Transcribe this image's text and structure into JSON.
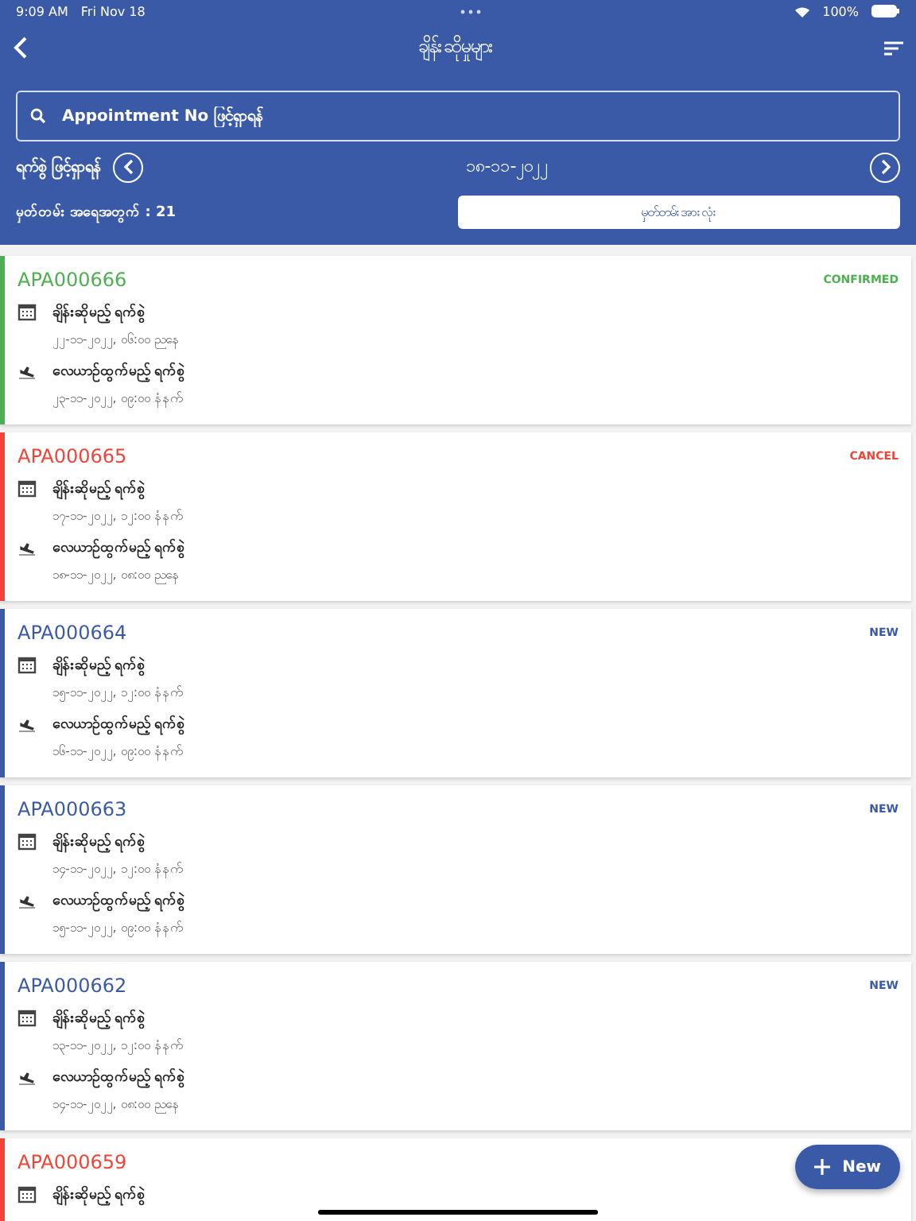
{
  "status_bar": {
    "time": "9:09 AM",
    "date": "Fri Nov 18",
    "battery": "100%"
  },
  "nav": {
    "title": "ချိန်းဆိုမှုများ"
  },
  "search": {
    "placeholder": "Appointment No ဖြင့်ရှာရန်"
  },
  "date_filter": {
    "label": "ရက်စွဲ ဖြင့်ရှာရန်",
    "date": "၁၈-၁၁-၂၀၂၂"
  },
  "summary": {
    "count_label": "မှတ်တမ်း အရေအတွက် : 21",
    "all_button": "မှတ်တမ်းအားလုံး"
  },
  "appointments": [
    {
      "id": "APA000666",
      "status": "CONFIRMED",
      "color": "#4caf50",
      "rows": [
        {
          "kind": "calendar",
          "label": "ချိန်းဆိုမည့် ရက်စွဲ",
          "value": "၂၂-၁၁-၂၀၂၂, ၀၆:၀၀ ညနေ"
        },
        {
          "kind": "flight",
          "label": "လေယာဉ်ထွက်မည့် ရက်စွဲ",
          "value": "၂၃-၁၁-၂၀၂၂, ၀၉:၀၀ နံနက်"
        }
      ]
    },
    {
      "id": "APA000665",
      "status": "CANCEL",
      "color": "#f44336",
      "rows": [
        {
          "kind": "calendar",
          "label": "ချိန်းဆိုမည့် ရက်စွဲ",
          "value": "၁၇-၁၁-၂၀၂၂, ၁၂:၀၀ နံနက်"
        },
        {
          "kind": "flight",
          "label": "လေယာဉ်ထွက်မည့် ရက်စွဲ",
          "value": "၁၈-၁၁-၂၀၂၂, ၀၈:၀၀ ညနေ"
        }
      ]
    },
    {
      "id": "APA000664",
      "status": "NEW",
      "color": "#3a5aa8",
      "rows": [
        {
          "kind": "calendar",
          "label": "ချိန်းဆိုမည့် ရက်စွဲ",
          "value": "၁၅-၁၁-၂၀၂၂, ၁၂:၀၀ နံနက်"
        },
        {
          "kind": "flight",
          "label": "လေယာဉ်ထွက်မည့် ရက်စွဲ",
          "value": "၁၆-၁၁-၂၀၂၂, ၀၉:၀၀ နံနက်"
        }
      ]
    },
    {
      "id": "APA000663",
      "status": "NEW",
      "color": "#3a5aa8",
      "rows": [
        {
          "kind": "calendar",
          "label": "ချိန်းဆိုမည့် ရက်စွဲ",
          "value": "၁၄-၁၁-၂၀၂၂, ၁၂:၀၀ နံနက်"
        },
        {
          "kind": "flight",
          "label": "လေယာဉ်ထွက်မည့် ရက်စွဲ",
          "value": "၁၅-၁၁-၂၀၂၂, ၀၉:၀၀ နံနက်"
        }
      ]
    },
    {
      "id": "APA000662",
      "status": "NEW",
      "color": "#3a5aa8",
      "rows": [
        {
          "kind": "calendar",
          "label": "ချိန်းဆိုမည့် ရက်စွဲ",
          "value": "၁၃-၁၁-၂၀၂၂, ၁၂:၀၀ နံနက်"
        },
        {
          "kind": "flight",
          "label": "လေယာဉ်ထွက်မည့် ရက်စွဲ",
          "value": "၁၄-၁၁-၂၀၂၂, ၀၈:၀၀ ညနေ"
        }
      ]
    },
    {
      "id": "APA000659",
      "color": "#f44336",
      "rows": [
        {
          "kind": "calendar",
          "label": "ချိန်းဆိုမည့် ရက်စွဲ"
        }
      ]
    }
  ],
  "fab": {
    "label": "New"
  }
}
